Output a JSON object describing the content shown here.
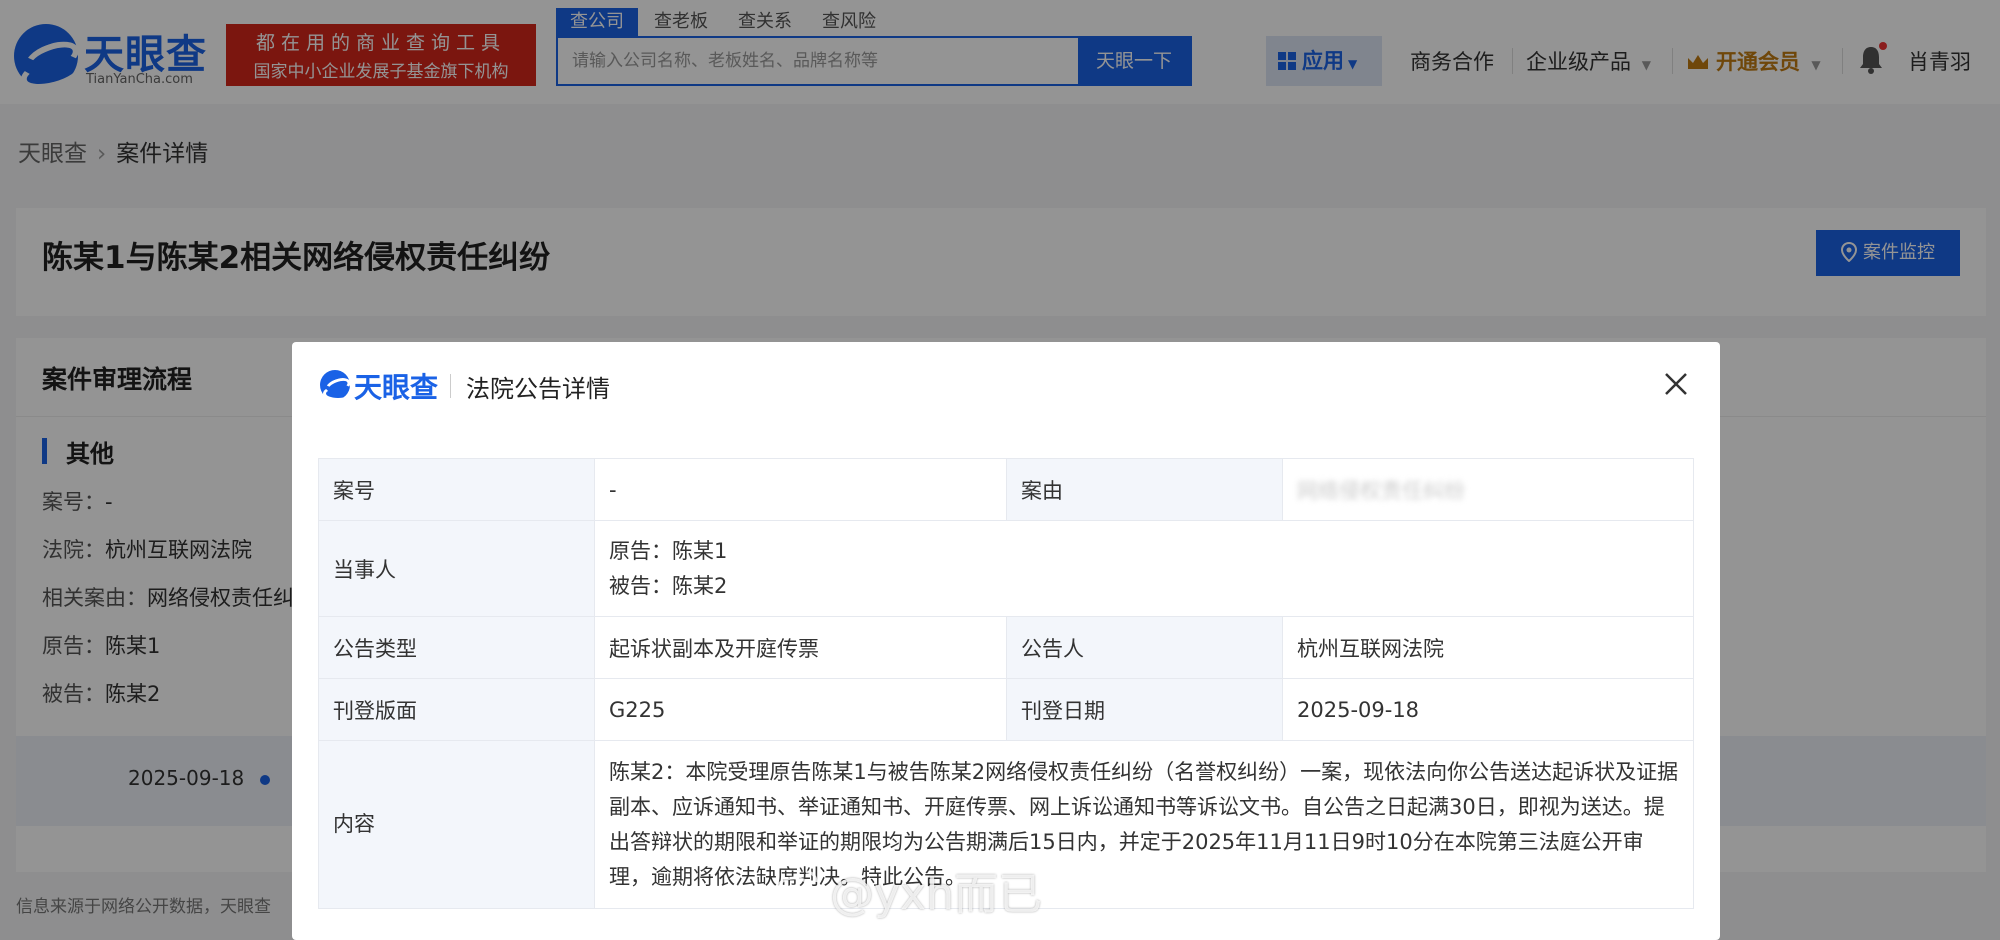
{
  "header": {
    "logo_text": "天眼查",
    "logo_sub": "TianYanCha.com",
    "slogan_line1": "都在用的商业查询工具",
    "slogan_line2": "国家中小企业发展子基金旗下机构",
    "search_tabs": [
      "查公司",
      "查老板",
      "查关系",
      "查风险"
    ],
    "search_placeholder": "请输入公司名称、老板姓名、品牌名称等",
    "search_button": "天眼一下",
    "nav_app": "应用",
    "nav_business": "商务合作",
    "nav_enterprise": "企业级产品",
    "nav_vip": "开通会员",
    "user_name": "肖青羽",
    "accent_color": "#1a62e6",
    "vip_color": "#c07a12"
  },
  "breadcrumb": {
    "home": "天眼查",
    "current": "案件详情"
  },
  "case": {
    "title": "陈某1与陈某2相关网络侵权责任纠纷",
    "monitor_button": "案件监控"
  },
  "flow": {
    "title": "案件审理流程",
    "section": "其他",
    "rows": [
      {
        "label": "案号：",
        "value": "-"
      },
      {
        "label": "法院：",
        "value": "杭州互联网法院"
      },
      {
        "label": "相关案由：",
        "value": "网络侵权责任纠"
      },
      {
        "label": "原告：",
        "value": "陈某1"
      },
      {
        "label": "被告：",
        "value": "陈某2"
      }
    ],
    "timeline_date": "2025-09-18",
    "footer_note": "信息来源于网络公开数据，天眼查"
  },
  "modal": {
    "logo_text": "天眼查",
    "title": "法院公告详情",
    "labels": {
      "case_no": "案号",
      "cause": "案由",
      "parties": "当事人",
      "notice_type": "公告类型",
      "announcer": "公告人",
      "page": "刊登版面",
      "date": "刊登日期",
      "content": "内容"
    },
    "values": {
      "case_no": "-",
      "cause": "网络侵权责任纠纷",
      "plaintiff": "原告：陈某1",
      "defendant": "被告：陈某2",
      "notice_type": "起诉状副本及开庭传票",
      "announcer": "杭州互联网法院",
      "page": "G225",
      "date": "2025-09-18",
      "content": "陈某2：本院受理原告陈某1与被告陈某2网络侵权责任纠纷（名誉权纠纷）一案，现依法向你公告送达起诉状及证据副本、应诉通知书、举证通知书、开庭传票、网上诉讼通知书等诉讼文书。自公告之日起满30日，即视为送达。提出答辩状的期限和举证的期限均为公告期满后15日内，并定于2025年11月11日9时10分在本院第三法庭公开审理，逾期将依法缺席判决。特此公告。"
    }
  },
  "watermark": "@yxh而已"
}
